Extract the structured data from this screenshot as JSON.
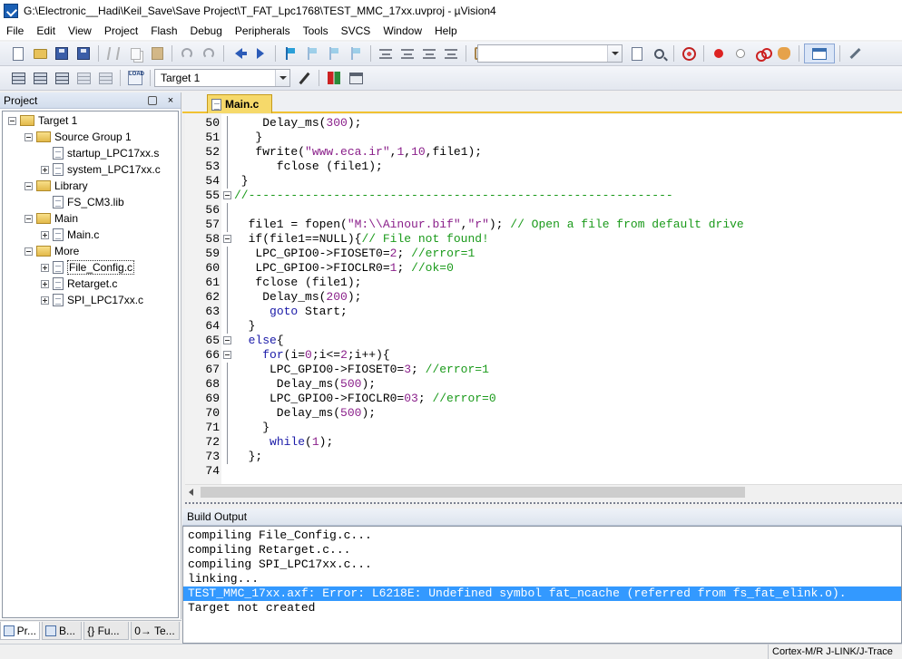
{
  "window": {
    "title": "G:\\Electronic__Hadi\\Keil_Save\\Save Project\\T_FAT_Lpc1768\\TEST_MMC_17xx.uvproj - µVision4"
  },
  "menu": [
    "File",
    "Edit",
    "View",
    "Project",
    "Flash",
    "Debug",
    "Peripherals",
    "Tools",
    "SVCS",
    "Window",
    "Help"
  ],
  "toolbar2": {
    "load_label": "LOAD",
    "target_select": "Target 1"
  },
  "project_panel": {
    "title": "Project",
    "close": "×",
    "tree": [
      {
        "label": "Target 1",
        "type": "folder",
        "level": 0
      },
      {
        "label": "Source Group 1",
        "type": "folder",
        "level": 1
      },
      {
        "label": "startup_LPC17xx.s",
        "type": "file",
        "level": 2
      },
      {
        "label": "system_LPC17xx.c",
        "type": "file",
        "level": 2
      },
      {
        "label": "Library",
        "type": "folder",
        "level": 1
      },
      {
        "label": "FS_CM3.lib",
        "type": "file",
        "level": 2
      },
      {
        "label": "Main",
        "type": "folder",
        "level": 1
      },
      {
        "label": "Main.c",
        "type": "file",
        "level": 2
      },
      {
        "label": "More",
        "type": "folder",
        "level": 1
      },
      {
        "label": "File_Config.c",
        "type": "file",
        "level": 2
      },
      {
        "label": "Retarget.c",
        "type": "file",
        "level": 2
      },
      {
        "label": "SPI_LPC17xx.c",
        "type": "file",
        "level": 2
      }
    ]
  },
  "left_tabs": [
    "Pr...",
    "B...",
    "{} Fu...",
    "0→ Te..."
  ],
  "editor": {
    "tab_label": "Main.c",
    "lines": [
      {
        "n": "50",
        "fold": "",
        "segs": [
          [
            "",
            "    Delay_ms("
          ],
          [
            "num",
            "300"
          ],
          [
            "",
            ");"
          ]
        ]
      },
      {
        "n": "51",
        "fold": "",
        "segs": [
          [
            "",
            "   }"
          ]
        ]
      },
      {
        "n": "52",
        "fold": "",
        "segs": [
          [
            "",
            "   fwrite("
          ],
          [
            "str",
            "\"www.eca.ir\""
          ],
          [
            "",
            ","
          ],
          [
            "num",
            "1"
          ],
          [
            "",
            ","
          ],
          [
            "num",
            "10"
          ],
          [
            "",
            ",file1);"
          ]
        ]
      },
      {
        "n": "53",
        "fold": "",
        "segs": [
          [
            "",
            "      fclose (file1);"
          ]
        ]
      },
      {
        "n": "54",
        "fold": "",
        "segs": [
          [
            "",
            " }"
          ]
        ]
      },
      {
        "n": "55",
        "fold": "box",
        "segs": [
          [
            "cmt",
            "//------------------------------------------------------------"
          ]
        ]
      },
      {
        "n": "56",
        "fold": "",
        "segs": [
          [
            "",
            ""
          ]
        ]
      },
      {
        "n": "57",
        "fold": "",
        "segs": [
          [
            "",
            "  file1 = fopen("
          ],
          [
            "str",
            "\"M:\\\\Ainour.bif\""
          ],
          [
            "",
            ","
          ],
          [
            "str",
            "\"r\""
          ],
          [
            "",
            "); "
          ],
          [
            "cmt",
            "// Open a file from default drive"
          ]
        ]
      },
      {
        "n": "58",
        "fold": "box",
        "segs": [
          [
            "",
            "  if(file1==NULL){"
          ],
          [
            "cmt",
            "// File not found!"
          ]
        ]
      },
      {
        "n": "59",
        "fold": "",
        "segs": [
          [
            "",
            "   LPC_GPIO0->FIOSET0="
          ],
          [
            "num",
            "2"
          ],
          [
            "",
            "; "
          ],
          [
            "cmt",
            "//error=1"
          ]
        ]
      },
      {
        "n": "60",
        "fold": "",
        "segs": [
          [
            "",
            "   LPC_GPIO0->FIOCLR0="
          ],
          [
            "num",
            "1"
          ],
          [
            "",
            "; "
          ],
          [
            "cmt",
            "//ok=0"
          ]
        ]
      },
      {
        "n": "61",
        "fold": "",
        "segs": [
          [
            "",
            "   fclose (file1);"
          ]
        ]
      },
      {
        "n": "62",
        "fold": "",
        "segs": [
          [
            "",
            "    Delay_ms("
          ],
          [
            "num",
            "200"
          ],
          [
            "",
            ");"
          ]
        ]
      },
      {
        "n": "63",
        "fold": "",
        "segs": [
          [
            "",
            "     "
          ],
          [
            "kw",
            "goto"
          ],
          [
            "",
            " Start;"
          ]
        ]
      },
      {
        "n": "64",
        "fold": "",
        "segs": [
          [
            "",
            "  }"
          ]
        ]
      },
      {
        "n": "65",
        "fold": "box",
        "segs": [
          [
            "",
            "  "
          ],
          [
            "kw",
            "else"
          ],
          [
            "",
            "{"
          ]
        ]
      },
      {
        "n": "66",
        "fold": "box",
        "segs": [
          [
            "",
            "    "
          ],
          [
            "kw",
            "for"
          ],
          [
            "",
            "(i="
          ],
          [
            "num",
            "0"
          ],
          [
            "",
            ";i<="
          ],
          [
            "num",
            "2"
          ],
          [
            "",
            ";i++){"
          ]
        ]
      },
      {
        "n": "67",
        "fold": "",
        "segs": [
          [
            "",
            "     LPC_GPIO0->FIOSET0="
          ],
          [
            "num",
            "3"
          ],
          [
            "",
            "; "
          ],
          [
            "cmt",
            "//error=1"
          ]
        ]
      },
      {
        "n": "68",
        "fold": "",
        "segs": [
          [
            "",
            "      Delay_ms("
          ],
          [
            "num",
            "500"
          ],
          [
            "",
            ");"
          ]
        ]
      },
      {
        "n": "69",
        "fold": "",
        "segs": [
          [
            "",
            "     LPC_GPIO0->FIOCLR0="
          ],
          [
            "num",
            "03"
          ],
          [
            "",
            "; "
          ],
          [
            "cmt",
            "//error=0"
          ]
        ]
      },
      {
        "n": "70",
        "fold": "",
        "segs": [
          [
            "",
            "      Delay_ms("
          ],
          [
            "num",
            "500"
          ],
          [
            "",
            ");"
          ]
        ]
      },
      {
        "n": "71",
        "fold": "",
        "segs": [
          [
            "",
            "    }"
          ]
        ]
      },
      {
        "n": "72",
        "fold": "",
        "segs": [
          [
            "",
            "     "
          ],
          [
            "kw",
            "while"
          ],
          [
            "",
            "("
          ],
          [
            "num",
            "1"
          ],
          [
            "",
            ");"
          ]
        ]
      },
      {
        "n": "73",
        "fold": "",
        "segs": [
          [
            "",
            "  };"
          ]
        ]
      },
      {
        "n": "74",
        "fold": "",
        "segs": [
          [
            "",
            ""
          ]
        ]
      }
    ]
  },
  "build_output": {
    "title": "Build Output",
    "lines": [
      {
        "text": "compiling File_Config.c...",
        "highlight": false
      },
      {
        "text": "compiling Retarget.c...",
        "highlight": false
      },
      {
        "text": "compiling SPI_LPC17xx.c...",
        "highlight": false
      },
      {
        "text": "linking...",
        "highlight": false
      },
      {
        "text": "TEST_MMC_17xx.axf: Error: L6218E: Undefined symbol fat_ncache (referred from fs_fat_elink.o).",
        "highlight": true
      },
      {
        "text": "Target not created",
        "highlight": false
      }
    ]
  },
  "status": {
    "debugger": "Cortex-M/R J-LINK/J-Trace"
  }
}
